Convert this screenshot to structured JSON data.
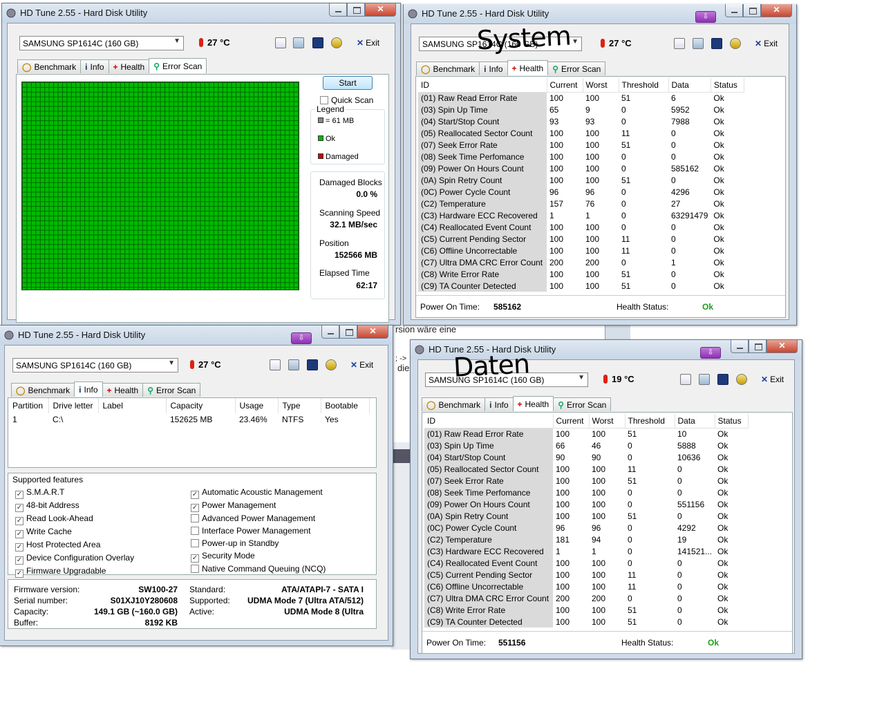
{
  "background": {
    "fragment_text": "rsion wäre eine",
    "fragment2": "; ->",
    "fragment3": "die"
  },
  "common": {
    "tabs": [
      {
        "label": "Benchmark",
        "icon": "benchmark-icon"
      },
      {
        "label": "Info",
        "icon": "info-icon"
      },
      {
        "label": "Health",
        "icon": "health-icon"
      },
      {
        "label": "Error Scan",
        "icon": "magnifier-icon"
      }
    ],
    "exit_label": "Exit",
    "app_title": "HD Tune 2.55 - Hard Disk Utility",
    "columns": [
      "ID",
      "Current",
      "Worst",
      "Threshold",
      "Data",
      "Status"
    ],
    "power_on_label": "Power On Time:",
    "health_status_label": "Health Status:",
    "colors": {
      "ok": "#1aa01a",
      "scan_ok": "#00bb00",
      "damaged": "#cc0000"
    }
  },
  "w1": {
    "title": "HD Tune 2.55 - Hard Disk Utility",
    "drive": "SAMSUNG SP1614C (160 GB)",
    "temp": "27 °C",
    "start": "Start",
    "quick_scan": "Quick Scan",
    "legend_title": "Legend",
    "legend_block": "= 61 MB",
    "legend_ok": "Ok",
    "legend_damaged": "Damaged",
    "damaged_label": "Damaged Blocks",
    "damaged_value": "0.0 %",
    "speed_label": "Scanning Speed",
    "speed_value": "32.1 MB/sec",
    "position_label": "Position",
    "position_value": "152566 MB",
    "elapsed_label": "Elapsed Time",
    "elapsed_value": "62:17"
  },
  "w2": {
    "title": "HD Tune 2.55 - Hard Disk Utility",
    "drive": "SAMSUNG SP1614C (160 GB)",
    "temp": "27 °C",
    "handwriting": "System",
    "rows": [
      [
        "(01) Raw Read Error Rate",
        "100",
        "100",
        "51",
        "6",
        "Ok"
      ],
      [
        "(03) Spin Up Time",
        "65",
        "9",
        "0",
        "5952",
        "Ok"
      ],
      [
        "(04) Start/Stop Count",
        "93",
        "93",
        "0",
        "7988",
        "Ok"
      ],
      [
        "(05) Reallocated Sector Count",
        "100",
        "100",
        "11",
        "0",
        "Ok"
      ],
      [
        "(07) Seek Error Rate",
        "100",
        "100",
        "51",
        "0",
        "Ok"
      ],
      [
        "(08) Seek Time Perfomance",
        "100",
        "100",
        "0",
        "0",
        "Ok"
      ],
      [
        "(09) Power On Hours Count",
        "100",
        "100",
        "0",
        "585162",
        "Ok"
      ],
      [
        "(0A) Spin Retry Count",
        "100",
        "100",
        "51",
        "0",
        "Ok"
      ],
      [
        "(0C) Power Cycle Count",
        "96",
        "96",
        "0",
        "4296",
        "Ok"
      ],
      [
        "(C2) Temperature",
        "157",
        "76",
        "0",
        "27",
        "Ok"
      ],
      [
        "(C3) Hardware ECC Recovered",
        "1",
        "1",
        "0",
        "63291479",
        "Ok"
      ],
      [
        "(C4) Reallocated Event Count",
        "100",
        "100",
        "0",
        "0",
        "Ok"
      ],
      [
        "(C5) Current Pending Sector",
        "100",
        "100",
        "11",
        "0",
        "Ok"
      ],
      [
        "(C6) Offline Uncorrectable",
        "100",
        "100",
        "11",
        "0",
        "Ok"
      ],
      [
        "(C7) Ultra DMA CRC Error Count",
        "200",
        "200",
        "0",
        "1",
        "Ok"
      ],
      [
        "(C8) Write Error Rate",
        "100",
        "100",
        "51",
        "0",
        "Ok"
      ],
      [
        "(C9) TA Counter Detected",
        "100",
        "100",
        "51",
        "0",
        "Ok"
      ]
    ],
    "power_on": "585162",
    "health": "Ok"
  },
  "w3": {
    "title": "HD Tune 2.55 - Hard Disk Utility",
    "drive": "SAMSUNG SP1614C (160 GB)",
    "temp": "27 °C",
    "part_cols": [
      "Partition",
      "Drive letter",
      "Label",
      "Capacity",
      "Usage",
      "Type",
      "Bootable"
    ],
    "part_row": [
      "1",
      "C:\\",
      "",
      "152625 MB",
      "23.46%",
      "NTFS",
      "Yes"
    ],
    "features_title": "Supported features",
    "features_left": [
      {
        "label": "S.M.A.R.T",
        "checked": true
      },
      {
        "label": "48-bit Address",
        "checked": true
      },
      {
        "label": "Read Look-Ahead",
        "checked": true
      },
      {
        "label": "Write Cache",
        "checked": true
      },
      {
        "label": "Host Protected Area",
        "checked": true
      },
      {
        "label": "Device Configuration Overlay",
        "checked": true
      },
      {
        "label": "Firmware Upgradable",
        "checked": true
      }
    ],
    "features_right": [
      {
        "label": "Automatic Acoustic Management",
        "checked": true
      },
      {
        "label": "Power Management",
        "checked": true
      },
      {
        "label": "Advanced Power Management",
        "checked": false
      },
      {
        "label": "Interface Power Management",
        "checked": false
      },
      {
        "label": "Power-up in Standby",
        "checked": false
      },
      {
        "label": "Security Mode",
        "checked": true
      },
      {
        "label": "Native Command Queuing (NCQ)",
        "checked": false
      }
    ],
    "fw_label": "Firmware version:",
    "fw": "SW100-27",
    "serial_label": "Serial number:",
    "serial": "S01XJ10Y280608",
    "cap_label": "Capacity:",
    "cap": "149.1 GB (~160.0 GB)",
    "buf_label": "Buffer:",
    "buf": "8192 KB",
    "std_label": "Standard:",
    "std": "ATA/ATAPI-7 - SATA I",
    "sup_label": "Supported:",
    "sup": "UDMA Mode 7 (Ultra ATA/512)",
    "act_label": "Active:",
    "act": "UDMA Mode 8 (Ultra"
  },
  "w4": {
    "title": "HD Tune 2.55 - Hard Disk Utility",
    "drive": "SAMSUNG SP1614C (160 GB)",
    "temp": "19 °C",
    "handwriting": "Daten",
    "rows": [
      [
        "(01) Raw Read Error Rate",
        "100",
        "100",
        "51",
        "10",
        "Ok"
      ],
      [
        "(03) Spin Up Time",
        "66",
        "46",
        "0",
        "5888",
        "Ok"
      ],
      [
        "(04) Start/Stop Count",
        "90",
        "90",
        "0",
        "10636",
        "Ok"
      ],
      [
        "(05) Reallocated Sector Count",
        "100",
        "100",
        "11",
        "0",
        "Ok"
      ],
      [
        "(07) Seek Error Rate",
        "100",
        "100",
        "51",
        "0",
        "Ok"
      ],
      [
        "(08) Seek Time Perfomance",
        "100",
        "100",
        "0",
        "0",
        "Ok"
      ],
      [
        "(09) Power On Hours Count",
        "100",
        "100",
        "0",
        "551156",
        "Ok"
      ],
      [
        "(0A) Spin Retry Count",
        "100",
        "100",
        "51",
        "0",
        "Ok"
      ],
      [
        "(0C) Power Cycle Count",
        "96",
        "96",
        "0",
        "4292",
        "Ok"
      ],
      [
        "(C2) Temperature",
        "181",
        "94",
        "0",
        "19",
        "Ok"
      ],
      [
        "(C3) Hardware ECC Recovered",
        "1",
        "1",
        "0",
        "141521...",
        "Ok"
      ],
      [
        "(C4) Reallocated Event Count",
        "100",
        "100",
        "0",
        "0",
        "Ok"
      ],
      [
        "(C5) Current Pending Sector",
        "100",
        "100",
        "11",
        "0",
        "Ok"
      ],
      [
        "(C6) Offline Uncorrectable",
        "100",
        "100",
        "11",
        "0",
        "Ok"
      ],
      [
        "(C7) Ultra DMA CRC Error Count",
        "200",
        "200",
        "0",
        "0",
        "Ok"
      ],
      [
        "(C8) Write Error Rate",
        "100",
        "100",
        "51",
        "0",
        "Ok"
      ],
      [
        "(C9) TA Counter Detected",
        "100",
        "100",
        "51",
        "0",
        "Ok"
      ]
    ],
    "power_on": "551156",
    "health": "Ok"
  }
}
